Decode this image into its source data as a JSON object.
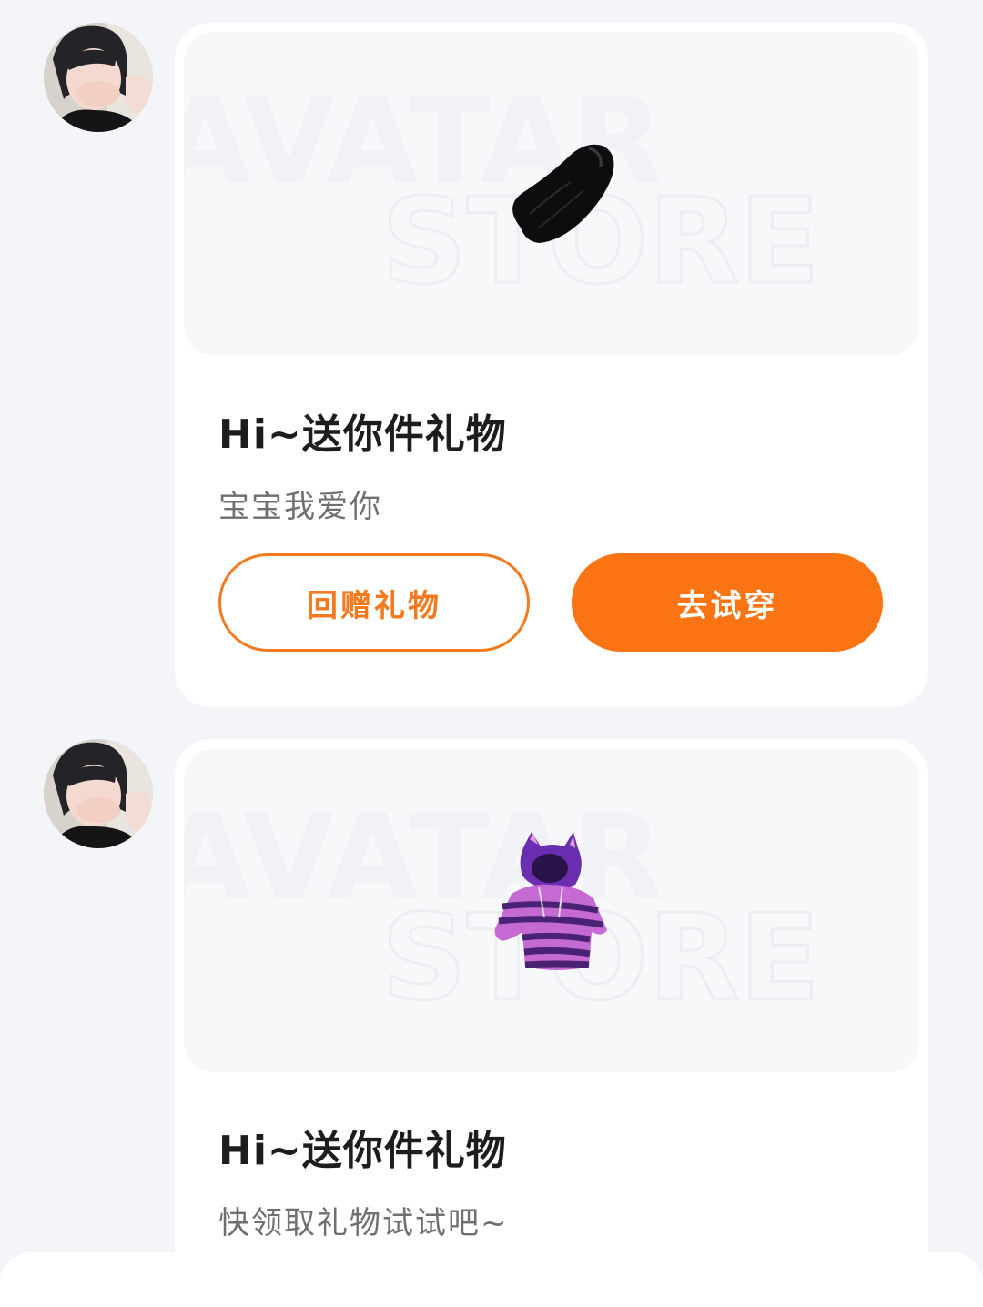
{
  "messages": [
    {
      "sender_avatar": "user-avatar",
      "gift_item": "black-fur-tail",
      "watermark": [
        "AVATAR",
        "STORE"
      ],
      "title": "Hi~送你件礼物",
      "subtitle": "宝宝我爱你",
      "buttons": {
        "return_gift": "回赠礼物",
        "try_on": "去试穿"
      }
    },
    {
      "sender_avatar": "user-avatar",
      "gift_item": "purple-striped-cat-hoodie",
      "watermark": [
        "AVATAR",
        "STORE"
      ],
      "title": "Hi~送你件礼物",
      "subtitle": "快领取礼物试试吧~"
    }
  ],
  "colors": {
    "accent": "#fa7414",
    "background": "#f3f5f8",
    "card": "#ffffff"
  }
}
